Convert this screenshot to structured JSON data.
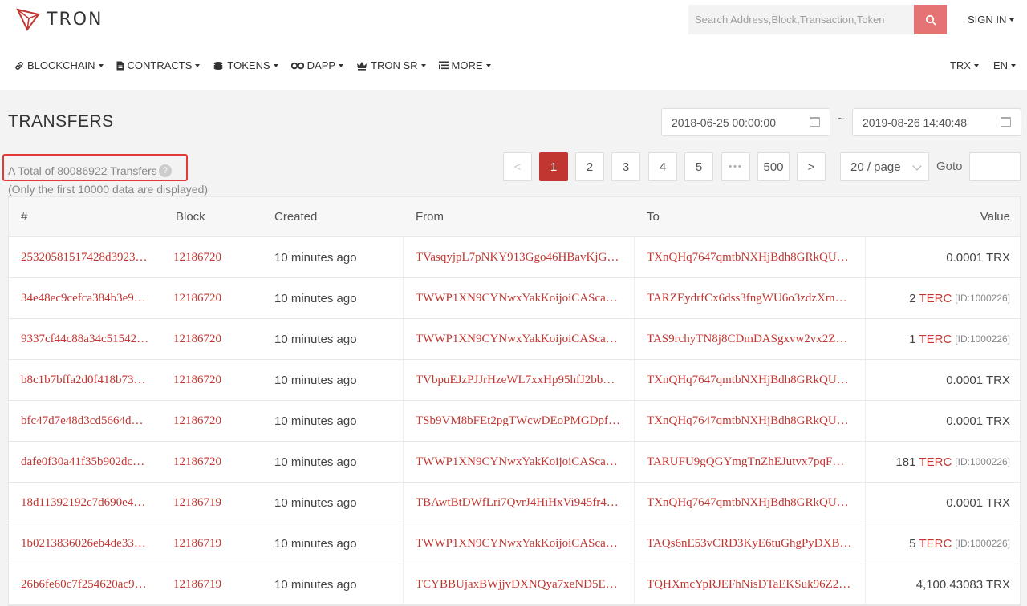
{
  "brand": {
    "name": "TRON"
  },
  "search": {
    "placeholder": "Search Address,Block,Transaction,Token"
  },
  "header": {
    "signin": "SIGN IN"
  },
  "nav": {
    "items": [
      {
        "label": "BLOCKCHAIN",
        "icon": "link-icon"
      },
      {
        "label": "CONTRACTS",
        "icon": "document-icon"
      },
      {
        "label": "TOKENS",
        "icon": "coins-icon"
      },
      {
        "label": "DAPP",
        "icon": "glasses-icon"
      },
      {
        "label": "TRON SR",
        "icon": "crown-icon"
      },
      {
        "label": "MORE",
        "icon": "list-icon"
      }
    ],
    "currency": "TRX",
    "language": "EN"
  },
  "page": {
    "title": "TRANSFERS",
    "date_from": "2018-06-25 00:00:00",
    "date_sep": "~",
    "date_to": "2019-08-26 14:40:48",
    "total": "A Total of 80086922 Transfers",
    "limit_note": "(Only the first 10000 data are displayed)"
  },
  "pagination": {
    "prev": "<",
    "pages": [
      "1",
      "2",
      "3",
      "4",
      "5"
    ],
    "ellipsis": "•••",
    "last": "500",
    "next": ">",
    "page_size": "20 / page",
    "goto_label": "Goto"
  },
  "table": {
    "columns": [
      "#",
      "Block",
      "Created",
      "From",
      "To",
      "Value"
    ],
    "rows": [
      {
        "hash": "25320581517428d3923…",
        "block": "12186720",
        "created": "10 minutes ago",
        "from": "TVasqyjpL7pNKY913Ggo46HBavKjG…",
        "to": "TXnQHq7647qmtbNXHjBdh8GRkQU…",
        "amount": "0.0001 TRX",
        "unit": "",
        "token_id": ""
      },
      {
        "hash": "34e48ec9cefca384b3e9…",
        "block": "12186720",
        "created": "10 minutes ago",
        "from": "TWWP1XN9CYNwxYakKoijoiCASca…",
        "to": "TARZEydrfCx6dss3fngWU6o3zdzXm…",
        "amount": "2",
        "unit": "TERC",
        "token_id": "[ID:1000226]"
      },
      {
        "hash": "9337cf44c88a34c51542…",
        "block": "12186720",
        "created": "10 minutes ago",
        "from": "TWWP1XN9CYNwxYakKoijoiCASca…",
        "to": "TAS9rchyTN8j8CDmDASgxvw2vx2Z…",
        "amount": "1",
        "unit": "TERC",
        "token_id": "[ID:1000226]"
      },
      {
        "hash": "b8c1b7bffa2d0f418b73…",
        "block": "12186720",
        "created": "10 minutes ago",
        "from": "TVbpuEJzPJJrHzeWL7xxHp95hfJ2bb…",
        "to": "TXnQHq7647qmtbNXHjBdh8GRkQU…",
        "amount": "0.0001 TRX",
        "unit": "",
        "token_id": ""
      },
      {
        "hash": "bfc47d7e48d3cd5664d…",
        "block": "12186720",
        "created": "10 minutes ago",
        "from": "TSb9VM8bFEt2pgTWcwDEoPMGDpf…",
        "to": "TXnQHq7647qmtbNXHjBdh8GRkQU…",
        "amount": "0.0001 TRX",
        "unit": "",
        "token_id": ""
      },
      {
        "hash": "dafe0f30a41f35b902dc…",
        "block": "12186720",
        "created": "10 minutes ago",
        "from": "TWWP1XN9CYNwxYakKoijoiCASca…",
        "to": "TARUFU9gQGYmgTnZhEJutvx7pqF…",
        "amount": "181",
        "unit": "TERC",
        "token_id": "[ID:1000226]"
      },
      {
        "hash": "18d11392192c7d690e4…",
        "block": "12186719",
        "created": "10 minutes ago",
        "from": "TBAwtBtDWfLri7QvrJ4HiHxVi945fr4…",
        "to": "TXnQHq7647qmtbNXHjBdh8GRkQU…",
        "amount": "0.0001 TRX",
        "unit": "",
        "token_id": ""
      },
      {
        "hash": "1b0213836026eb4de33…",
        "block": "12186719",
        "created": "10 minutes ago",
        "from": "TWWP1XN9CYNwxYakKoijoiCASca…",
        "to": "TAQs6nE53vCRD3KyE6tuGhgPyDXB…",
        "amount": "5",
        "unit": "TERC",
        "token_id": "[ID:1000226]"
      },
      {
        "hash": "26b6fe60c7f254620ac9…",
        "block": "12186719",
        "created": "10 minutes ago",
        "from": "TCYBBUjaxBWjjvDXNQya7xeND5E…",
        "to": "TQHXmcYpRJEFhNisDTaEKSuk96Z2…",
        "amount": "4,100.43083 TRX",
        "unit": "",
        "token_id": ""
      }
    ]
  },
  "colors": {
    "accent": "#c23631",
    "search_button": "#e57373",
    "highlight": "#e53935"
  }
}
